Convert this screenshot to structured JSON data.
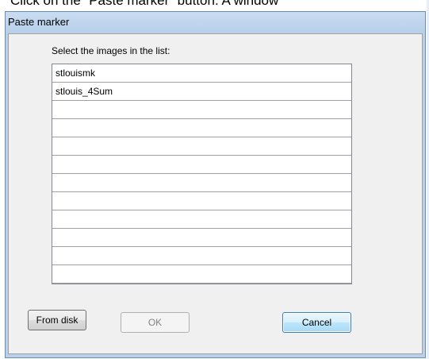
{
  "caption": {
    "text": "Click on the “Paste marker” button. A window"
  },
  "window": {
    "title": "Paste marker"
  },
  "dialog": {
    "prompt": "Select the images in the list:",
    "list_items": [
      "stlouismk",
      "stlouis_4Sum",
      "",
      "",
      "",
      "",
      "",
      "",
      "",
      "",
      "",
      ""
    ]
  },
  "buttons": {
    "from_disk": "From disk",
    "ok": "OK",
    "cancel": "Cancel"
  },
  "colors": {
    "title_bar": "#b9d0ea",
    "client_bg": "#f0f0f0",
    "default_button_border": "#3c7fb1",
    "disabled_text": "#838383"
  }
}
